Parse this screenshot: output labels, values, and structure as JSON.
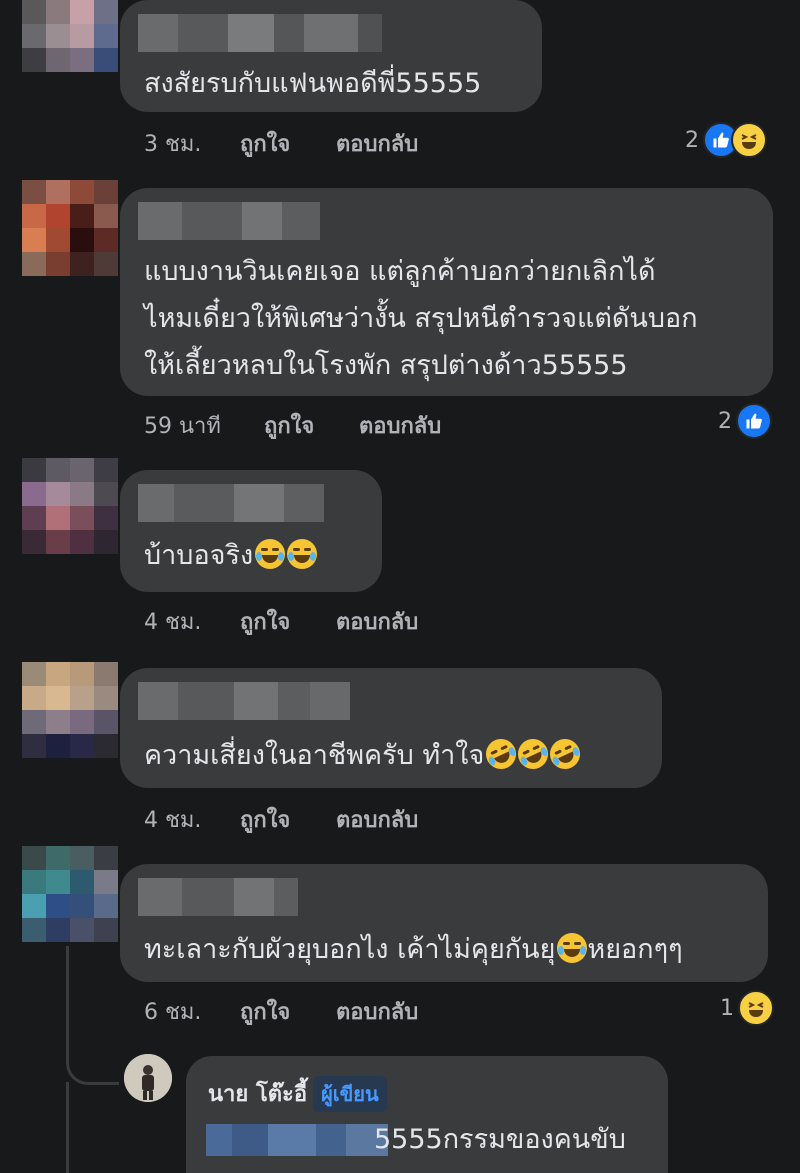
{
  "comments": [
    {
      "text_lines": [
        "สงสัยรบกับแฟนพอดีพี่55555"
      ],
      "time": "3 ชม.",
      "like_label": "ถูกใจ",
      "reply_label": "ตอบกลับ",
      "reaction_count": "2",
      "reactions": [
        "like-icon",
        "haha-icon"
      ]
    },
    {
      "text_lines": [
        "แบบงานวินเคยเจอ แต่ลูกค้าบอกว่ายกเลิกได้",
        "ไหมเดี๋ยวให้พิเศษว่างั้น สรุปหนีตำรวจแต่ดันบอก",
        "ให้เลี้ยวหลบในโรงพัก สรุปต่างด้าว55555"
      ],
      "time": "59 นาที",
      "like_label": "ถูกใจ",
      "reply_label": "ตอบกลับ",
      "reaction_count": "2",
      "reactions": [
        "like-icon"
      ]
    },
    {
      "text_lines": [
        "บ้าบอจริง"
      ],
      "emoji_after": [
        "joy-emoji",
        "joy-emoji"
      ],
      "time": "4 ชม.",
      "like_label": "ถูกใจ",
      "reply_label": "ตอบกลับ"
    },
    {
      "text_lines": [
        "ความเสี่ยงในอาชีพครับ ทำใจ"
      ],
      "emoji_after": [
        "rofl-emoji",
        "rofl-emoji",
        "rofl-emoji"
      ],
      "time": "4 ชม.",
      "like_label": "ถูกใจ",
      "reply_label": "ตอบกลับ"
    },
    {
      "text_before": "ทะเลาะกับผัวยุบอกไง เค้าไม่คุยกันยุ",
      "text_after": "หยอกๆๆ",
      "inline_emoji": "joy-emoji",
      "time": "6 ชม.",
      "like_label": "ถูกใจ",
      "reply_label": "ตอบกลับ",
      "reaction_count": "1",
      "reactions": [
        "haha-icon"
      ]
    }
  ],
  "reply": {
    "author": "นาย โต๊ะอี้",
    "author_badge": "ผู้เขียน",
    "text": "5555กรรมของคนขับ"
  },
  "colors": {
    "background": "#18191a",
    "bubble": "#3a3b3c",
    "text": "#e4e6eb",
    "meta": "#b0b3b8",
    "like_blue": "#1877f2",
    "badge_text": "#4599ff"
  }
}
